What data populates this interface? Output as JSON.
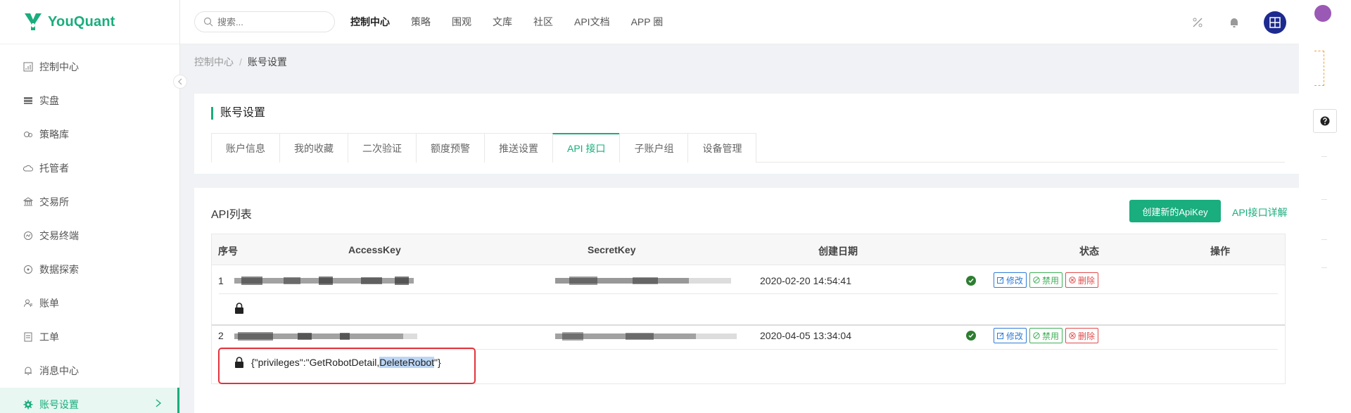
{
  "brand": {
    "name": "YouQuant"
  },
  "sidebar": {
    "items": [
      {
        "label": "控制中心",
        "icon": "dashboard-icon"
      },
      {
        "label": "实盘",
        "icon": "server-icon"
      },
      {
        "label": "策略库",
        "icon": "strategy-icon"
      },
      {
        "label": "托管者",
        "icon": "cloud-icon"
      },
      {
        "label": "交易所",
        "icon": "bank-icon"
      },
      {
        "label": "交易终端",
        "icon": "terminal-icon"
      },
      {
        "label": "数据探索",
        "icon": "compass-icon"
      },
      {
        "label": "账单",
        "icon": "user-bill-icon"
      },
      {
        "label": "工单",
        "icon": "ticket-icon"
      },
      {
        "label": "消息中心",
        "icon": "bell-icon"
      },
      {
        "label": "账号设置",
        "icon": "gear-icon",
        "active": true
      }
    ]
  },
  "header": {
    "search_placeholder": "搜索...",
    "nav": [
      "控制中心",
      "策略",
      "围观",
      "文库",
      "社区",
      "API文档",
      "APP 圈"
    ]
  },
  "breadcrumb": {
    "root": "控制中心",
    "separator": "/",
    "current": "账号设置"
  },
  "account": {
    "title": "账号设置",
    "tabs": [
      "账户信息",
      "我的收藏",
      "二次验证",
      "额度预警",
      "推送设置",
      "API 接口",
      "子账户组",
      "设备管理"
    ],
    "active_tab": "API 接口"
  },
  "api": {
    "title": "API列表",
    "create_button": "创建新的ApiKey",
    "detail_link": "API接口详解",
    "columns": [
      "序号",
      "AccessKey",
      "SecretKey",
      "创建日期",
      "状态",
      "操作"
    ],
    "rows": [
      {
        "index": "1",
        "created": "2020-02-20 14:54:41",
        "privileges": ""
      },
      {
        "index": "2",
        "created": "2020-04-05 13:34:04",
        "privileges": "{\"privileges\":\"GetRobotDetail,DeleteRobot\"}",
        "privileges_pre": "{\"privileges\":\"GetRobotDetail,",
        "privileges_hl": "DeleteRobot",
        "privileges_post": "\"}"
      }
    ],
    "actions": {
      "edit": "修改",
      "disable": "禁用",
      "delete": "删除"
    }
  },
  "colors": {
    "accent": "#1aad7e",
    "edit": "#2f7bd8",
    "disable": "#3fb058",
    "delete": "#e04b4b",
    "status_ok": "#2e7d32"
  }
}
